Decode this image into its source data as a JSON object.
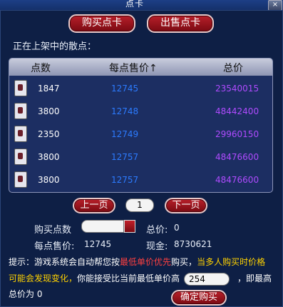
{
  "window": {
    "title": "点卡",
    "close_label": "×"
  },
  "top_tabs": {
    "buy": "购买点卡",
    "sell": "出售点卡"
  },
  "section_label": "正在上架中的散点：",
  "table": {
    "headers": {
      "points": "点数",
      "unit_price": "每点售价",
      "sort_indicator": "↑",
      "total": "总价"
    },
    "rows": [
      {
        "points": "1847",
        "unit_price": "12745",
        "total": "23540015"
      },
      {
        "points": "3800",
        "unit_price": "12748",
        "total": "48442400"
      },
      {
        "points": "2350",
        "unit_price": "12749",
        "total": "29960150"
      },
      {
        "points": "3800",
        "unit_price": "12757",
        "total": "48476600"
      },
      {
        "points": "3800",
        "unit_price": "12757",
        "total": "48476600"
      }
    ]
  },
  "pager": {
    "prev": "上一页",
    "page": "1",
    "next": "下一页"
  },
  "form": {
    "buy_points_label": "购买点数",
    "buy_points_value": "",
    "total_label": "总价:",
    "total_value": "0",
    "unit_price_label": "每点售价:",
    "unit_price_value": "12745",
    "cash_label": "现金:",
    "cash_value": "8730621"
  },
  "tip": {
    "prefix": "提示：",
    "part1": "游戏系统会自动帮您按",
    "part2": "最低单价优先",
    "part3": "购买，",
    "part4": "当多人购买时价格",
    "part5": "可能会发现变化，",
    "part6": "你能接受比当前最低单价高",
    "max_increase": "254",
    "part7": "，即最高",
    "part8": "总价为",
    "max_total": "0"
  },
  "confirm_button": "确定购买",
  "colors": {
    "points": "#ffffff",
    "unit_price": "#2c7bff",
    "total": "#b04bff",
    "highlight_yellow": "#ffd200",
    "highlight_red": "#ff4040"
  }
}
